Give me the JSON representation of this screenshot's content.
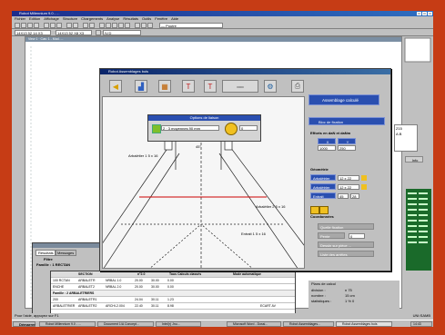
{
  "app": {
    "title": "Robot Millennium 9.0 - ...",
    "menu": [
      "Fichier",
      "Edition",
      "Affichage",
      "Structure",
      "Chargements",
      "Analyse",
      "Résultats",
      "Outils",
      "Fenêtre",
      "Aide"
    ],
    "combo_1": "14X13 52 14 X3",
    "combo_2": "14X13 52 X8 X3",
    "combo_3": "IV.D",
    "combo_4": "— Poutre",
    "canvas_title": "View 1 · Cas: 1 - Mod. ..."
  },
  "dialog": {
    "title": "Robot Assemblages bois",
    "draw_window_title": "Options de liaison",
    "connection_type": "2 · 3 moyennes 90 mm",
    "spin_value": "0",
    "member_label_1": "Arbalétier 1 5 x 16",
    "member_label_2": "Arbalétier 2 5 x 16",
    "member_label_3": "Entrait 1 5 x 16",
    "angle_label": "45°",
    "assembly_button": "Assemblage calculé",
    "member_select": "Bloc de fixation",
    "section_label_1": "Efforts en daN et daNm",
    "col_header_1": "X",
    "col_header_2": "Y",
    "value_1": "1000",
    "value_2": "250",
    "sub_section": "Géométrie",
    "btn_arb1": "Arbalétrier",
    "btn_arb2": "Arbalétrier",
    "btn_ent": "Entrait",
    "field_arb1": "12 x 22",
    "field_arb2": "12 x 22",
    "field_ent": "45",
    "field_ent2": "28",
    "lower_section": "Coordonnées",
    "gray_btn_1": "Quelle fixation",
    "gray_btn_2": "Pente",
    "gray_field_2": "0",
    "gray_btn_3": "Dessin sur pièce ...",
    "gray_btn_4": "Liste des arrêtes",
    "side_list_1": "Z15",
    "side_list_2": "A.B",
    "side_button": "Info"
  },
  "bottom_window": {
    "tab_1": "Résultats",
    "tab_2": "Messages",
    "header": "Filtre",
    "family_label": "Famille : 1 RECTAN"
  },
  "table": {
    "header_1": "SECTION",
    "header_2": "n°2.0",
    "header_3": "Tous Calculs classés",
    "header_4": "Mode automatique",
    "rows": [
      {
        "c1": "100 RCTAN",
        "c2": "ARBALETR",
        "c3": "NRBAL 1.0",
        "c4": "20.00",
        "c5": "30.00",
        "c6": "0.00"
      },
      {
        "c1": "ENCHE",
        "c2": "ARBALET2",
        "c3": "NRBAL 2.0",
        "c4": "20.00",
        "c5": "30.00",
        "c6": "0.00"
      },
      {
        "c1": "Famille : 2 ARBALETRIERS",
        "c2": "",
        "c3": "",
        "c4": "",
        "c5": "",
        "c6": ""
      },
      {
        "c1": "200",
        "c2": "ARBALETR1",
        "c3": "",
        "c4": "24.04",
        "c5": "30.11",
        "c6": "1.23"
      },
      {
        "c1": "ARBALETRIER",
        "c2": "ARBALETR2",
        "c3": "ARCHI-2.004",
        "c4": "22.40",
        "c5": "30.11",
        "c6": "8.98"
      }
    ],
    "extra": "ECART AV"
  },
  "info_panel": {
    "line_1": "Plans de calcul",
    "line_2": "division :",
    "line_3": "nombre :",
    "line_4": "statistiques :",
    "value_1": "n 75",
    "value_2": "15 cm",
    "value_3": "1 % 0"
  },
  "taskbar": {
    "start": "Démarrer",
    "tasks": [
      "Robot Millennium 9.0 - ...",
      "Document 1/A Concept...",
      "Intel(r) Jnu...",
      "Microsoft Word - Dossi...",
      "Robot Assemblages...",
      "Robot Assemblages bois"
    ],
    "clock": "14:43"
  },
  "status": {
    "left": "Pour l'aide, appuyez sur F1",
    "right": "UNI:SAMB"
  }
}
